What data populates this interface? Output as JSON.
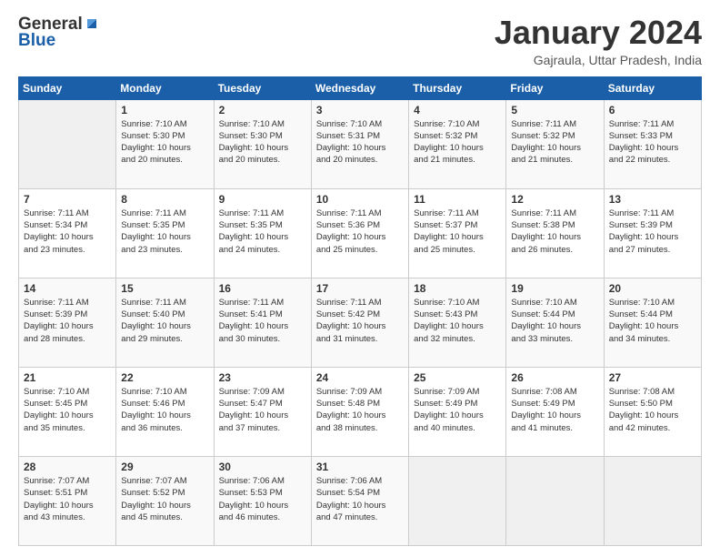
{
  "header": {
    "logo_line1": "General",
    "logo_line2": "Blue",
    "month_title": "January 2024",
    "location": "Gajraula, Uttar Pradesh, India"
  },
  "days_of_week": [
    "Sunday",
    "Monday",
    "Tuesday",
    "Wednesday",
    "Thursday",
    "Friday",
    "Saturday"
  ],
  "weeks": [
    [
      {
        "day": "",
        "info": ""
      },
      {
        "day": "1",
        "info": "Sunrise: 7:10 AM\nSunset: 5:30 PM\nDaylight: 10 hours\nand 20 minutes."
      },
      {
        "day": "2",
        "info": "Sunrise: 7:10 AM\nSunset: 5:30 PM\nDaylight: 10 hours\nand 20 minutes."
      },
      {
        "day": "3",
        "info": "Sunrise: 7:10 AM\nSunset: 5:31 PM\nDaylight: 10 hours\nand 20 minutes."
      },
      {
        "day": "4",
        "info": "Sunrise: 7:10 AM\nSunset: 5:32 PM\nDaylight: 10 hours\nand 21 minutes."
      },
      {
        "day": "5",
        "info": "Sunrise: 7:11 AM\nSunset: 5:32 PM\nDaylight: 10 hours\nand 21 minutes."
      },
      {
        "day": "6",
        "info": "Sunrise: 7:11 AM\nSunset: 5:33 PM\nDaylight: 10 hours\nand 22 minutes."
      }
    ],
    [
      {
        "day": "7",
        "info": "Sunrise: 7:11 AM\nSunset: 5:34 PM\nDaylight: 10 hours\nand 23 minutes."
      },
      {
        "day": "8",
        "info": "Sunrise: 7:11 AM\nSunset: 5:35 PM\nDaylight: 10 hours\nand 23 minutes."
      },
      {
        "day": "9",
        "info": "Sunrise: 7:11 AM\nSunset: 5:35 PM\nDaylight: 10 hours\nand 24 minutes."
      },
      {
        "day": "10",
        "info": "Sunrise: 7:11 AM\nSunset: 5:36 PM\nDaylight: 10 hours\nand 25 minutes."
      },
      {
        "day": "11",
        "info": "Sunrise: 7:11 AM\nSunset: 5:37 PM\nDaylight: 10 hours\nand 25 minutes."
      },
      {
        "day": "12",
        "info": "Sunrise: 7:11 AM\nSunset: 5:38 PM\nDaylight: 10 hours\nand 26 minutes."
      },
      {
        "day": "13",
        "info": "Sunrise: 7:11 AM\nSunset: 5:39 PM\nDaylight: 10 hours\nand 27 minutes."
      }
    ],
    [
      {
        "day": "14",
        "info": "Sunrise: 7:11 AM\nSunset: 5:39 PM\nDaylight: 10 hours\nand 28 minutes."
      },
      {
        "day": "15",
        "info": "Sunrise: 7:11 AM\nSunset: 5:40 PM\nDaylight: 10 hours\nand 29 minutes."
      },
      {
        "day": "16",
        "info": "Sunrise: 7:11 AM\nSunset: 5:41 PM\nDaylight: 10 hours\nand 30 minutes."
      },
      {
        "day": "17",
        "info": "Sunrise: 7:11 AM\nSunset: 5:42 PM\nDaylight: 10 hours\nand 31 minutes."
      },
      {
        "day": "18",
        "info": "Sunrise: 7:10 AM\nSunset: 5:43 PM\nDaylight: 10 hours\nand 32 minutes."
      },
      {
        "day": "19",
        "info": "Sunrise: 7:10 AM\nSunset: 5:44 PM\nDaylight: 10 hours\nand 33 minutes."
      },
      {
        "day": "20",
        "info": "Sunrise: 7:10 AM\nSunset: 5:44 PM\nDaylight: 10 hours\nand 34 minutes."
      }
    ],
    [
      {
        "day": "21",
        "info": "Sunrise: 7:10 AM\nSunset: 5:45 PM\nDaylight: 10 hours\nand 35 minutes."
      },
      {
        "day": "22",
        "info": "Sunrise: 7:10 AM\nSunset: 5:46 PM\nDaylight: 10 hours\nand 36 minutes."
      },
      {
        "day": "23",
        "info": "Sunrise: 7:09 AM\nSunset: 5:47 PM\nDaylight: 10 hours\nand 37 minutes."
      },
      {
        "day": "24",
        "info": "Sunrise: 7:09 AM\nSunset: 5:48 PM\nDaylight: 10 hours\nand 38 minutes."
      },
      {
        "day": "25",
        "info": "Sunrise: 7:09 AM\nSunset: 5:49 PM\nDaylight: 10 hours\nand 40 minutes."
      },
      {
        "day": "26",
        "info": "Sunrise: 7:08 AM\nSunset: 5:49 PM\nDaylight: 10 hours\nand 41 minutes."
      },
      {
        "day": "27",
        "info": "Sunrise: 7:08 AM\nSunset: 5:50 PM\nDaylight: 10 hours\nand 42 minutes."
      }
    ],
    [
      {
        "day": "28",
        "info": "Sunrise: 7:07 AM\nSunset: 5:51 PM\nDaylight: 10 hours\nand 43 minutes."
      },
      {
        "day": "29",
        "info": "Sunrise: 7:07 AM\nSunset: 5:52 PM\nDaylight: 10 hours\nand 45 minutes."
      },
      {
        "day": "30",
        "info": "Sunrise: 7:06 AM\nSunset: 5:53 PM\nDaylight: 10 hours\nand 46 minutes."
      },
      {
        "day": "31",
        "info": "Sunrise: 7:06 AM\nSunset: 5:54 PM\nDaylight: 10 hours\nand 47 minutes."
      },
      {
        "day": "",
        "info": ""
      },
      {
        "day": "",
        "info": ""
      },
      {
        "day": "",
        "info": ""
      }
    ]
  ]
}
